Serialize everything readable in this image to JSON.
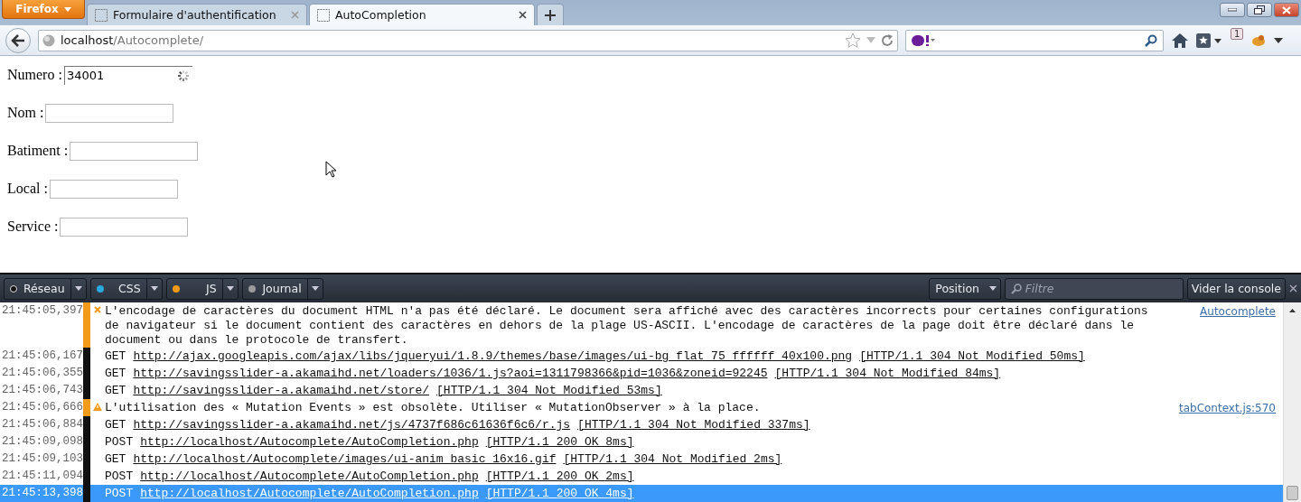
{
  "browser": {
    "menu_button": "Firefox",
    "tabs": [
      {
        "title": "Formulaire d'authentification",
        "selected": false
      },
      {
        "title": "AutoCompletion",
        "selected": true
      }
    ],
    "url": {
      "host": "localhost",
      "path": "/Autocomplete/"
    },
    "notification_count": "1"
  },
  "form": {
    "fields": [
      {
        "label": "Numero :",
        "value": "34001",
        "loading": true
      },
      {
        "label": "Nom :",
        "loading": false
      },
      {
        "label": "Batiment :",
        "loading": false
      },
      {
        "label": "Local :",
        "loading": false
      },
      {
        "label": "Service :",
        "loading": false
      }
    ]
  },
  "console": {
    "filters": [
      {
        "label": "Réseau",
        "color": "#111111"
      },
      {
        "label": "CSS",
        "color": "#2aa8e0"
      },
      {
        "label": "JS",
        "color": "#f29a1a"
      },
      {
        "label": "Journal",
        "color": "#9a9a9a"
      }
    ],
    "position_button": "Position",
    "filter_placeholder": "Filtre",
    "clear_button": "Vider la console",
    "entries": [
      {
        "kind": "error",
        "time": "21:45:05,397",
        "message": "L'encodage de caractères du document HTML n'a pas été déclaré. Le document sera affiché avec des caractères incorrects pour certaines configurations de navigateur si le document contient des caractères en dehors de la plage US-ASCII. L'encodage de caractères de la page doit être déclaré dans le document ou dans le protocole de transfert.",
        "source": "Autocomplete",
        "selected": false
      },
      {
        "kind": "network",
        "time": "21:45:06,167",
        "method": "GET",
        "url": "http://ajax.googleapis.com/ajax/libs/jqueryui/1.8.9/themes/base/images/ui-bg_flat_75_ffffff_40x100.png",
        "status": "[HTTP/1.1 304 Not Modified 50ms]",
        "selected": false
      },
      {
        "kind": "network",
        "time": "21:45:06,355",
        "method": "GET",
        "url": "http://savingsslider-a.akamaihd.net/loaders/1036/1.js?aoi=1311798366&pid=1036&zoneid=92245",
        "status": "[HTTP/1.1 304 Not Modified 84ms]",
        "selected": false
      },
      {
        "kind": "network",
        "time": "21:45:06,743",
        "method": "GET",
        "url": "http://savingsslider-a.akamaihd.net/store/",
        "status": "[HTTP/1.1 304 Not Modified 53ms]",
        "selected": false
      },
      {
        "kind": "warning",
        "time": "21:45:06,666",
        "message": "L'utilisation des « Mutation Events » est obsolète. Utiliser « MutationObserver » à la place.",
        "source": "tabContext.js:570",
        "selected": false
      },
      {
        "kind": "network",
        "time": "21:45:06,884",
        "method": "GET",
        "url": "http://savingsslider-a.akamaihd.net/js/4737f686c61636f6c6/r.js",
        "status": "[HTTP/1.1 304 Not Modified 337ms]",
        "selected": false
      },
      {
        "kind": "network",
        "time": "21:45:09,098",
        "method": "POST",
        "url": "http://localhost/Autocomplete/AutoCompletion.php",
        "status": "[HTTP/1.1 200 OK 8ms]",
        "selected": false
      },
      {
        "kind": "network",
        "time": "21:45:09,103",
        "method": "GET",
        "url": "http://localhost/Autocomplete/images/ui-anim_basic_16x16.gif",
        "status": "[HTTP/1.1 304 Not Modified 2ms]",
        "selected": false
      },
      {
        "kind": "network",
        "time": "21:45:11,094",
        "method": "POST",
        "url": "http://localhost/Autocomplete/AutoCompletion.php",
        "status": "[HTTP/1.1 200 OK 2ms]",
        "selected": false
      },
      {
        "kind": "network",
        "time": "21:45:13,398",
        "method": "POST",
        "url": "http://localhost/Autocomplete/AutoCompletion.php",
        "status": "[HTTP/1.1 200 OK 4ms]",
        "selected": true
      }
    ]
  }
}
